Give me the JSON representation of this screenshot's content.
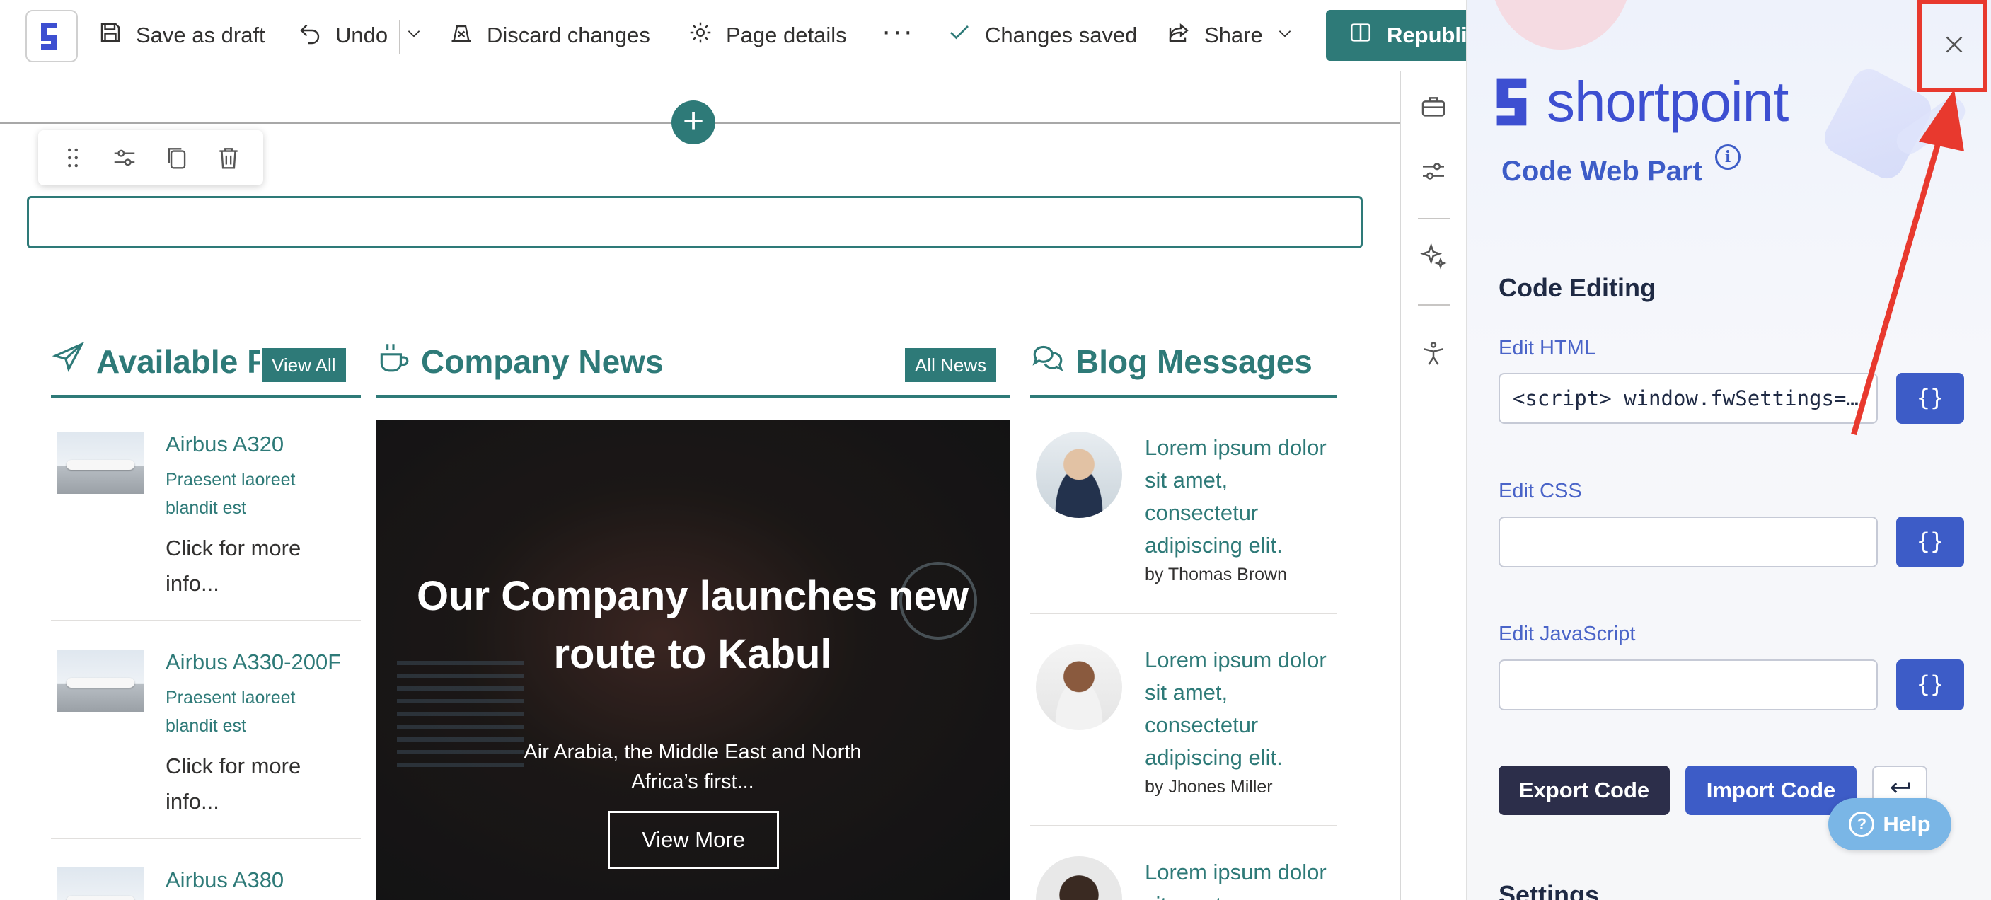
{
  "toolbar": {
    "save_draft": "Save as draft",
    "undo": "Undo",
    "discard": "Discard changes",
    "page_details": "Page details",
    "more": "···",
    "status": "Changes saved",
    "share": "Share",
    "republish": "Republish"
  },
  "canvas": {
    "add_section": "+",
    "columns": {
      "planes": {
        "title": "Available Planes",
        "badge": "View All",
        "items": [
          {
            "title": "Airbus A320",
            "subtitle": "Praesent laoreet blandit est",
            "more": "Click for more info..."
          },
          {
            "title": "Airbus A330-200F",
            "subtitle": "Praesent laoreet blandit est",
            "more": "Click for more info..."
          },
          {
            "title": "Airbus A380",
            "subtitle": "",
            "more": ""
          }
        ]
      },
      "news": {
        "title": "Company News",
        "badge": "All News",
        "feature": {
          "title": "Our Company launches new route to Kabul",
          "subtitle": "Air Arabia, the Middle East and North Africa’s first...",
          "button": "View More"
        }
      },
      "blog": {
        "title": "Blog Messages",
        "items": [
          {
            "title": "Lorem ipsum dolor sit amet, consectetur adipiscing elit.",
            "author": "by Thomas Brown"
          },
          {
            "title": "Lorem ipsum dolor sit amet, consectetur adipiscing elit.",
            "author": "by Jhones Miller"
          },
          {
            "title": "Lorem ipsum dolor sit amet",
            "author": ""
          }
        ]
      }
    }
  },
  "panel": {
    "brand": "shortpoint",
    "webpart_title": "Code Web Part",
    "info": "i",
    "section_code": "Code Editing",
    "html": {
      "label": "Edit HTML",
      "value": "<script>  window.fwSettings={...",
      "btn": "{}"
    },
    "css": {
      "label": "Edit CSS",
      "value": "",
      "btn": "{}"
    },
    "js": {
      "label": "Edit JavaScript",
      "value": "",
      "btn": "{}"
    },
    "export": "Export Code",
    "import": "Import Code",
    "help": "Help",
    "section_settings": "Settings"
  },
  "colors": {
    "theme_teal": "#2e7a78",
    "shortpoint_blue": "#3d5cc7",
    "highlight_red": "#e8392e"
  },
  "icons": {
    "toolbar": [
      "save-icon",
      "undo-icon",
      "chevron-down-icon",
      "discard-icon",
      "gear-icon",
      "checkmark-icon",
      "share-icon",
      "chevron-down-icon",
      "book-icon"
    ],
    "webpart_toolbar": [
      "drag-handle-icon",
      "settings-sliders-icon",
      "copy-icon",
      "trash-icon"
    ],
    "rail": [
      "toolbox-icon",
      "sliders-icon",
      "sparkle-icon",
      "accessibility-icon"
    ]
  }
}
